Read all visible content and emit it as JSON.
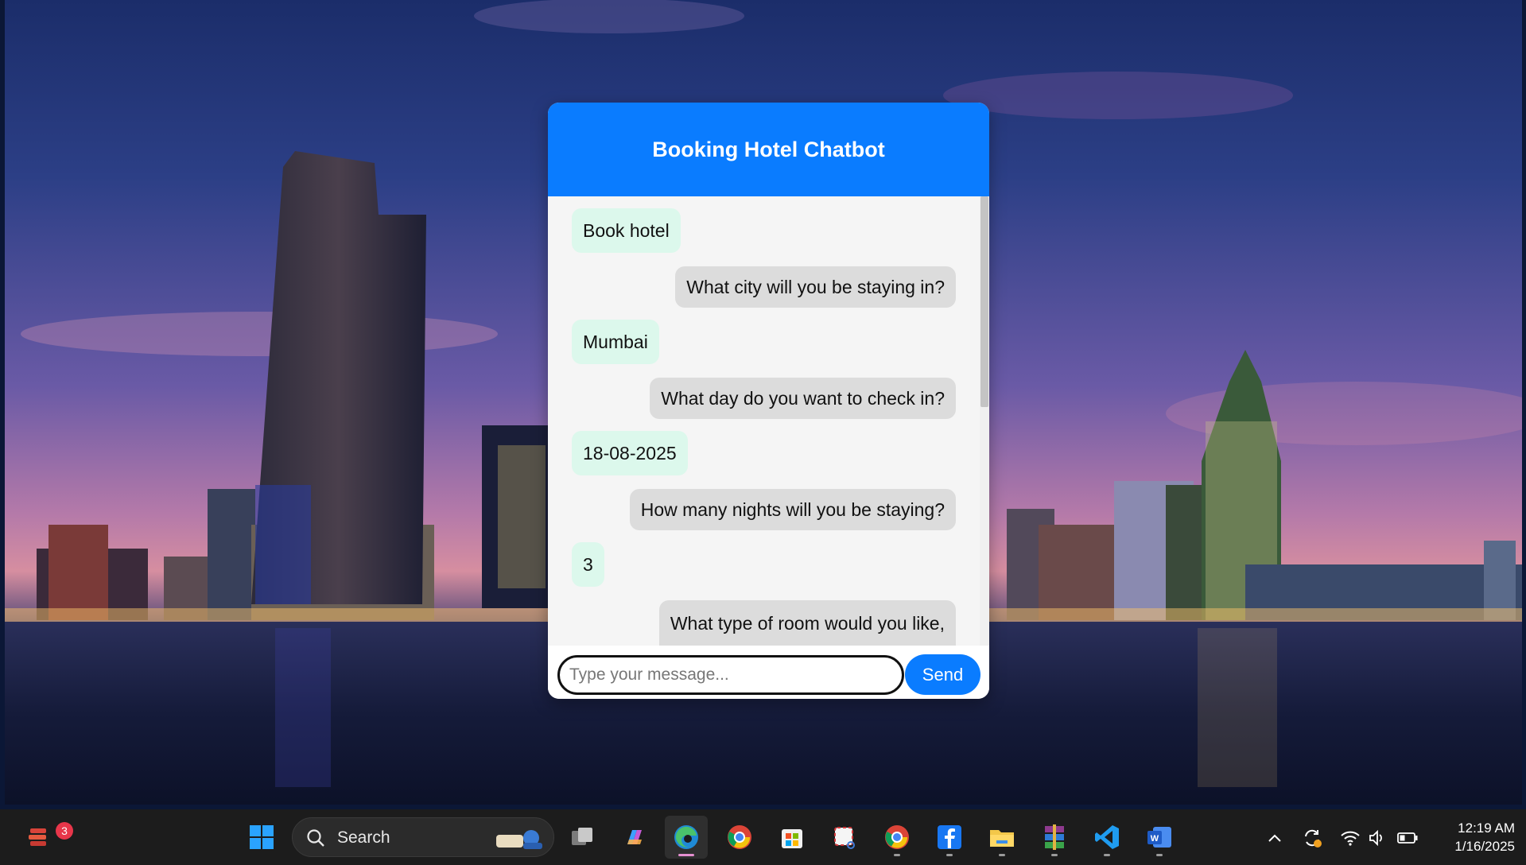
{
  "chat": {
    "title": "Booking Hotel Chatbot",
    "messages": [
      {
        "from": "user",
        "text": "Book hotel"
      },
      {
        "from": "bot",
        "text": "What city will you be staying in?"
      },
      {
        "from": "user",
        "text": "Mumbai"
      },
      {
        "from": "bot",
        "text": "What day do you want to check in?"
      },
      {
        "from": "user",
        "text": "18-08-2025"
      },
      {
        "from": "bot",
        "text": "How many nights will you be staying?"
      },
      {
        "from": "user",
        "text": "3"
      },
      {
        "from": "bot",
        "text": "What type of room would you like,"
      }
    ],
    "input_placeholder": "Type your message...",
    "send_label": "Send"
  },
  "taskbar": {
    "notification_count": "3",
    "search_label": "Search",
    "apps": [
      "start",
      "search",
      "task-view",
      "copilot",
      "edge",
      "chrome",
      "microsoft-store",
      "snipping-tool",
      "chrome",
      "facebook",
      "file-explorer",
      "winrar",
      "vscode",
      "word"
    ],
    "time": "12:19 AM",
    "date": "1/16/2025"
  },
  "colors": {
    "accent": "#0a7cff",
    "user_bubble": "#dcf8ec",
    "bot_bubble": "#dcdcdc",
    "taskbar": "#1c1c1c"
  }
}
